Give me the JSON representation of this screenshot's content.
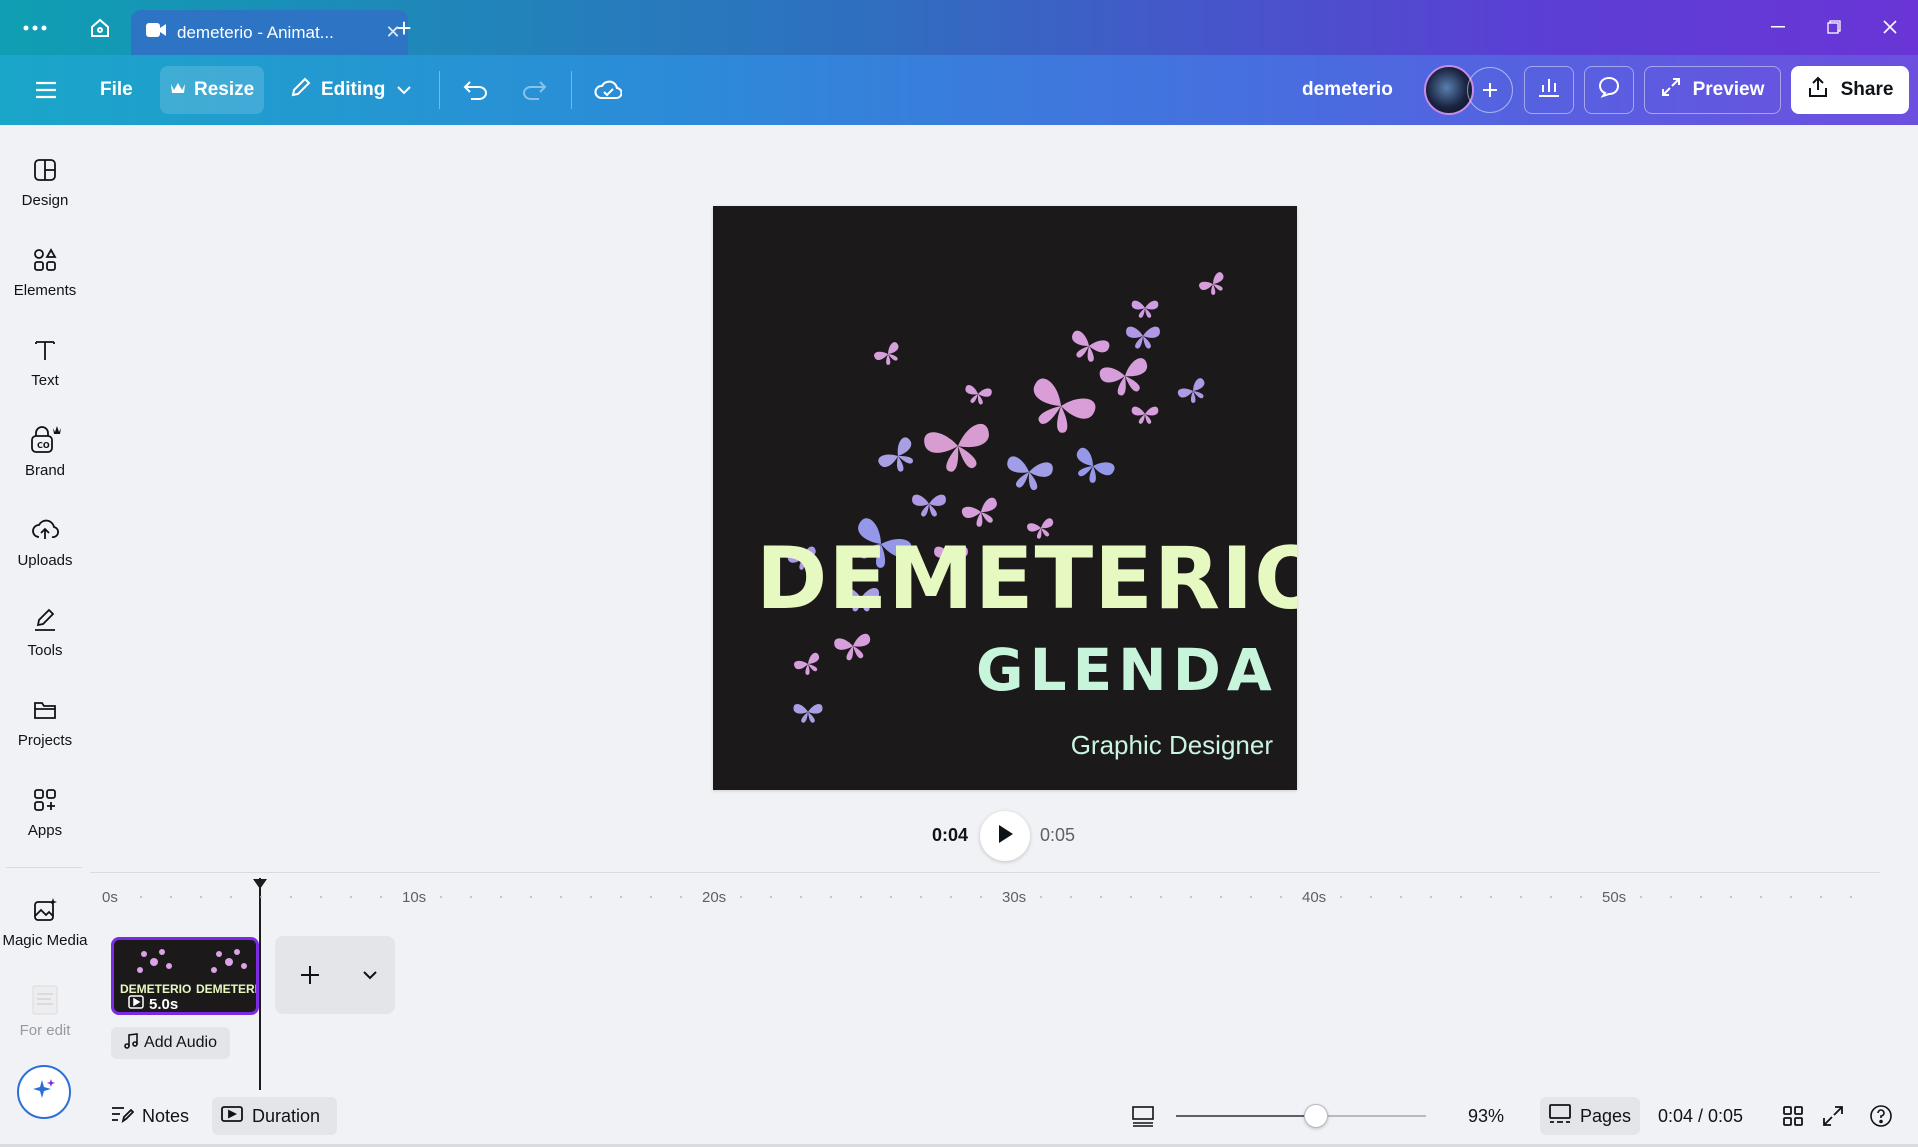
{
  "browser": {
    "tab_title": "demeterio - Animat...",
    "new_tab_symbol": "+",
    "tab_close_symbol": "✕"
  },
  "toolbar": {
    "file_label": "File",
    "resize_label": "Resize",
    "editing_label": "Editing",
    "design_name": "demeterio",
    "preview_label": "Preview",
    "share_label": "Share"
  },
  "sidebar": {
    "items": [
      {
        "label": "Design",
        "icon": "layout-icon"
      },
      {
        "label": "Elements",
        "icon": "shapes-icon"
      },
      {
        "label": "Text",
        "icon": "text-icon"
      },
      {
        "label": "Brand",
        "icon": "brand-icon"
      },
      {
        "label": "Uploads",
        "icon": "cloud-upload-icon"
      },
      {
        "label": "Tools",
        "icon": "pen-tool-icon"
      },
      {
        "label": "Projects",
        "icon": "folder-icon"
      },
      {
        "label": "Apps",
        "icon": "apps-icon"
      },
      {
        "label": "Magic Media",
        "icon": "magic-image-icon"
      },
      {
        "label": "For edit",
        "icon": "thumbnail-icon"
      }
    ]
  },
  "design": {
    "name": "DEMETERIO",
    "subname": "GLENDA",
    "role": "Graphic Designer",
    "colors": {
      "background": "#1c191b",
      "name": "#e6f9c0",
      "subname": "#c7f5dc"
    }
  },
  "playback": {
    "current": "0:04",
    "total": "0:05"
  },
  "timeline": {
    "ticks": [
      "0s",
      "10s",
      "20s",
      "30s",
      "40s",
      "50s"
    ],
    "clip": {
      "duration": "5.0s",
      "thumb_text_1": "DEMETERIO",
      "thumb_text_2": "DEMETERI"
    },
    "add_audio_label": "Add Audio"
  },
  "bottombar": {
    "notes_label": "Notes",
    "duration_label": "Duration",
    "zoom": "93%",
    "zoom_level": 0.56,
    "pages_label": "Pages",
    "time_readout": "0:04 / 0:05"
  },
  "colors": {
    "accent": "#7d2ae8",
    "toolbar_gradient_start": "#1aa6c9",
    "toolbar_gradient_end": "#6d4fe0"
  }
}
